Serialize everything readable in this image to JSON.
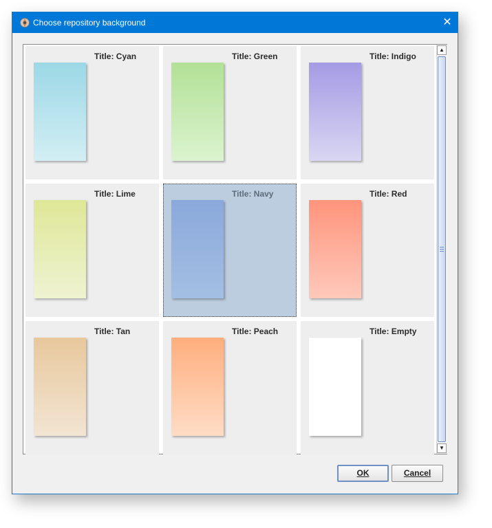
{
  "window": {
    "title": "Choose repository background",
    "close_glyph": "✕"
  },
  "backgrounds": [
    {
      "label": "Title: Cyan",
      "top": "#9bd8e6",
      "bottom": "#d3eef4",
      "selected": false
    },
    {
      "label": "Title: Green",
      "top": "#b2e196",
      "bottom": "#dbf3cf",
      "selected": false
    },
    {
      "label": "Title: Indigo",
      "top": "#a49be4",
      "bottom": "#d9d6f2",
      "selected": false
    },
    {
      "label": "Title: Lime",
      "top": "#dfe797",
      "bottom": "#eef3d1",
      "selected": false
    },
    {
      "label": "Title: Navy",
      "top": "#8aa8db",
      "bottom": "#a4bfe3",
      "selected": true
    },
    {
      "label": "Title: Red",
      "top": "#ff947c",
      "bottom": "#ffc9bb",
      "selected": false
    },
    {
      "label": "Title: Tan",
      "top": "#e8c89c",
      "bottom": "#f2e5d3",
      "selected": false
    },
    {
      "label": "Title: Peach",
      "top": "#ffae7d",
      "bottom": "#ffdcc6",
      "selected": false
    },
    {
      "label": "Title: Empty",
      "top": "#ffffff",
      "bottom": "#ffffff",
      "selected": false
    }
  ],
  "scrollbar": {
    "up_glyph": "▲",
    "down_glyph": "▼"
  },
  "buttons": {
    "ok": "OK",
    "cancel": "Cancel"
  }
}
